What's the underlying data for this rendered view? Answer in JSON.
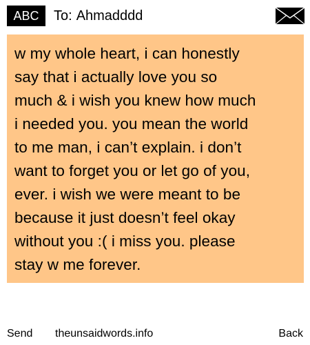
{
  "header": {
    "mode_label": "ABC",
    "recipient_prefix": "To:",
    "recipient_name": "Ahmadddd",
    "envelope_icon": "envelope-icon"
  },
  "message": {
    "text": "w my whole heart, i can honestly\nsay that i actually love you so\nmuch & i wish you knew how much\ni needed you. you mean the world\nto me man, i can’t explain. i don’t\nwant to forget you or let go of you,\never. i wish we were meant to be\nbecause it just doesn’t feel okay\nwithout you :( i miss you. please\nstay w me forever.",
    "background_color": "#ffc688"
  },
  "footer": {
    "send_label": "Send",
    "site_label": "theunsaidwords.info",
    "back_label": "Back"
  }
}
